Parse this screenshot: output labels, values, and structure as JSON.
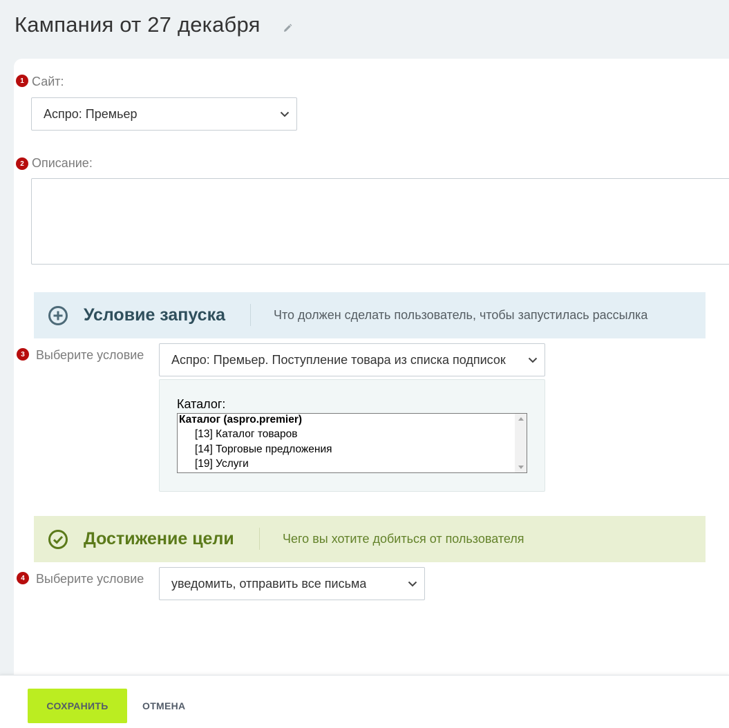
{
  "header": {
    "title": "Кампания от 27 декабря",
    "edit_icon": "pencil-icon"
  },
  "form": {
    "site": {
      "marker": "1",
      "label": "Сайт:",
      "value": "Аспро: Премьер"
    },
    "description": {
      "marker": "2",
      "label": "Описание:",
      "value": ""
    },
    "launch": {
      "icon": "plus-circle-icon",
      "title": "Условие запуска",
      "description": "Что должен сделать пользователь, чтобы запустилась рассылка",
      "band_color": "#e4eff5",
      "condition": {
        "marker": "3",
        "label": "Выберите условие",
        "value": "Аспро: Премьер. Поступление товара из списка подписок"
      },
      "catalog": {
        "label": "Каталог:",
        "options": [
          {
            "text": "Каталог (aspro.premier)",
            "type": "group"
          },
          {
            "text": "[13] Каталог товаров",
            "type": "child"
          },
          {
            "text": "[14] Торговые предложения",
            "type": "child"
          },
          {
            "text": "[19] Услуги",
            "type": "child"
          }
        ]
      }
    },
    "goal": {
      "icon": "check-circle-icon",
      "title": "Достижение цели",
      "description": "Чего вы хотите добиться от пользователя",
      "band_color": "#e9f0d3",
      "condition": {
        "marker": "4",
        "label": "Выберите условие",
        "value": "уведомить, отправить все письма"
      }
    }
  },
  "footer": {
    "save_label": "СОХРАНИТЬ",
    "cancel_label": "ОТМЕНА",
    "save_color": "#bbed21"
  },
  "marker_color": "#b70d0d"
}
